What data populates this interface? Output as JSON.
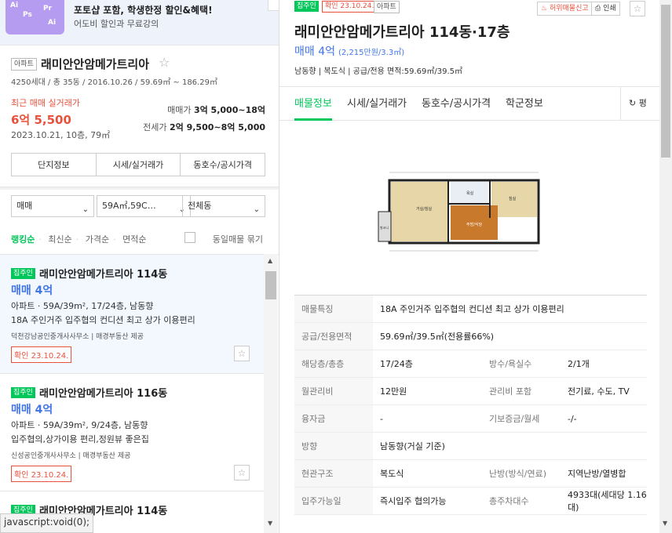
{
  "banner": {
    "title": "포토샵 포함, 학생한정 할인&혜택!",
    "subtitle": "어도비 할인과 무료강의"
  },
  "summary": {
    "type_tag": "아파트",
    "name": "래미안안암메가트리아",
    "info": "4250세대 / 총 35동 / 2016.10.26 / 59.69㎡ ~ 186.29㎡",
    "recent_label": "최근 매매 실거래가",
    "recent_price": "6억 5,500",
    "recent_date": "2023.10.21, 10층, 79㎡",
    "sale_label": "매매가",
    "sale_value": "3억 5,000~18억",
    "jeonse_label": "전세가",
    "jeonse_value": "2억 9,500~8억 5,000",
    "buttons": [
      "단지정보",
      "시세/실거래가",
      "동호수/공시가격"
    ]
  },
  "filters": {
    "trade": "매매",
    "area": "59A㎡,59C…",
    "dong": "전체동"
  },
  "sort": {
    "options": [
      "랭킹순",
      "최신순",
      "가격순",
      "면적순"
    ],
    "same_group": "동일매물 묶기"
  },
  "listings": [
    {
      "badge": "집주인",
      "name": "래미안안암메가트리아 114동",
      "price": "매매 4억",
      "spec": "아파트 · 59A/39m², 17/24층, 남동향",
      "desc": "18A 주인거주 입주협의 컨디션 최고 상가 이용편리",
      "agent": "덕천강남공인중개사사무소 | 매경부동산 제공",
      "confirm": "확인 23.10.24."
    },
    {
      "badge": "집주인",
      "name": "래미안안암메가트리아 116동",
      "price": "매매 4억",
      "spec": "아파트 · 59A/39m², 9/24층, 남동향",
      "desc": "입주협의,상가이용 편리,정원뷰 좋은집",
      "agent": "신성공인중개사사무소 | 매경부동산 제공",
      "confirm": "확인 23.10.24."
    },
    {
      "badge": "집주인",
      "name": "래미안안암메가트리아 114동",
      "price": "",
      "spec": "",
      "desc": "",
      "agent": "",
      "confirm": ""
    }
  ],
  "status_bar": "javascript:void(0);",
  "detail": {
    "badge": "집주인",
    "confirm": "확인 23.10.24.",
    "type": "아파트",
    "report": "허위매물신고",
    "print": "인쇄",
    "title": "래미안안암메가트리아 114동·17층",
    "price": "매매 4억",
    "unit_price": "(2,215만원/3.3㎡)",
    "meta": "남동향 | 복도식 | 공급/전용 면적:59.69㎡/39.5㎡",
    "tabs": [
      "매물정보",
      "시세/실거래가",
      "동호수/공시가격",
      "학군정보"
    ],
    "refresh": "평",
    "plan_labels": {
      "living": "거실/침실",
      "room": "침실",
      "kitchen": "주방/식당",
      "bath": "욕실",
      "balcony": "발코니"
    },
    "table": [
      {
        "k1": "매물특징",
        "v1": "18A 주인거주 입주협의 컨디션 최고 상가 이용편리"
      },
      {
        "k1": "공급/전용면적",
        "v1": "59.69㎡/39.5㎡(전용률66%)"
      },
      {
        "k1": "해당층/총층",
        "v1": "17/24층",
        "k2": "방수/욕실수",
        "v2": "2/1개"
      },
      {
        "k1": "월관리비",
        "v1": "12만원",
        "k2": "관리비 포함",
        "v2": "전기료, 수도, TV"
      },
      {
        "k1": "융자금",
        "v1": "-",
        "k2": "기보증금/월세",
        "v2": "-/-"
      },
      {
        "k1": "방향",
        "v1": "남동향(거실 기준)"
      },
      {
        "k1": "현관구조",
        "v1": "복도식",
        "k2": "난방(방식/연료)",
        "v2": "지역난방/열병합"
      },
      {
        "k1": "입주가능일",
        "v1": "즉시입주 협의가능",
        "k2": "총주차대수",
        "v2": "4933대(세대당 1.16대)"
      }
    ]
  }
}
